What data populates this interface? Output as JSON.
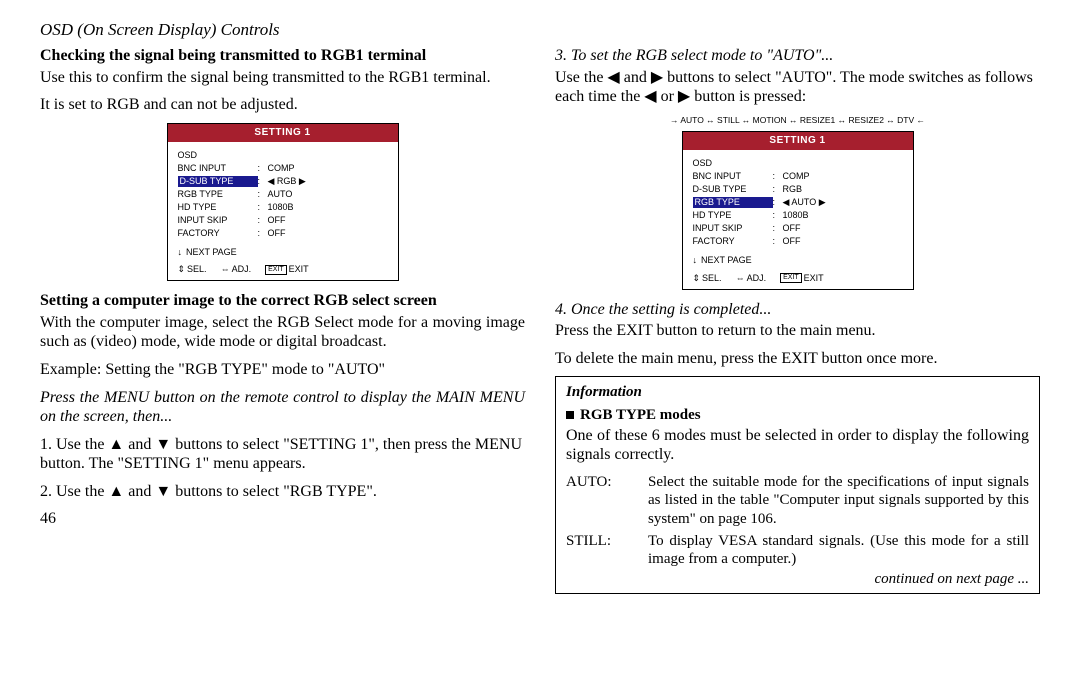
{
  "header": "OSD (On Screen Display) Controls",
  "left": {
    "t1": "Checking the signal being transmitted to RGB1 terminal",
    "p1": "Use this to confirm the signal being transmitted to the RGB1 terminal.",
    "p2": "It is set to RGB and can not be adjusted.",
    "t2": "Setting a computer image to the correct RGB select screen",
    "p3": "With the computer image, select the RGB Select mode for a moving image such as (video) mode, wide mode or digital broadcast.",
    "p4": "Example: Setting the \"RGB TYPE\" mode to \"AUTO\"",
    "p5": "Press the MENU button on the remote control to display the MAIN MENU on the screen, then...",
    "p6": "1. Use the ▲ and ▼ buttons to select \"SETTING 1\", then press the MENU button. The \"SETTING 1\" menu appears.",
    "p7": "2. Use the ▲ and ▼ buttons to select \"RGB TYPE\"."
  },
  "right": {
    "t1": "3. To set the RGB select mode to \"AUTO\"...",
    "p1": "Use the ◀ and ▶ buttons to select \"AUTO\". The mode switches as follows each time the ◀ or ▶ button is pressed:",
    "cycle": "→ AUTO ↔ STILL ↔ MOTION ↔ RESIZE1 ↔ RESIZE2 ↔ DTV ←",
    "t2": "4. Once the setting is completed...",
    "p2": "Press the EXIT button to return to the main menu.",
    "p3": "To delete the main menu, press the EXIT button once more."
  },
  "osd1": {
    "title": "SETTING 1",
    "rows": [
      {
        "l": "OSD",
        "v": ""
      },
      {
        "l": "BNC INPUT",
        "v": "COMP"
      },
      {
        "l": "D-SUB TYPE",
        "v": "◀ RGB ▶",
        "hl": true
      },
      {
        "l": "RGB TYPE",
        "v": "AUTO"
      },
      {
        "l": "HD TYPE",
        "v": "1080B"
      },
      {
        "l": "INPUT SKIP",
        "v": "OFF"
      },
      {
        "l": "FACTORY",
        "v": "OFF"
      }
    ],
    "next": "NEXT PAGE",
    "foot": {
      "sel": "SEL.",
      "adj": "ADJ.",
      "exit": "EXIT"
    }
  },
  "osd2": {
    "title": "SETTING 1",
    "rows": [
      {
        "l": "OSD",
        "v": ""
      },
      {
        "l": "BNC INPUT",
        "v": "COMP"
      },
      {
        "l": "D-SUB TYPE",
        "v": "RGB"
      },
      {
        "l": "RGB TYPE",
        "v": "◀ AUTO ▶",
        "hl": true
      },
      {
        "l": "HD TYPE",
        "v": "1080B"
      },
      {
        "l": "INPUT SKIP",
        "v": "OFF"
      },
      {
        "l": "FACTORY",
        "v": "OFF"
      }
    ],
    "next": "NEXT PAGE",
    "foot": {
      "sel": "SEL.",
      "adj": "ADJ.",
      "exit": "EXIT"
    }
  },
  "info": {
    "head": "Information",
    "sub": "RGB TYPE modes",
    "intro": "One of these 6 modes must be selected in order to display the following signals correctly.",
    "rows": [
      {
        "k": "AUTO:",
        "v": "Select the suitable mode for the specifications of input signals as listed in the table \"Computer input signals supported by this system\" on page 106."
      },
      {
        "k": "STILL:",
        "v": "To display VESA standard signals. (Use this mode for a still image from a computer.)"
      }
    ],
    "foot": "continued on next page ..."
  },
  "pageno": "46"
}
